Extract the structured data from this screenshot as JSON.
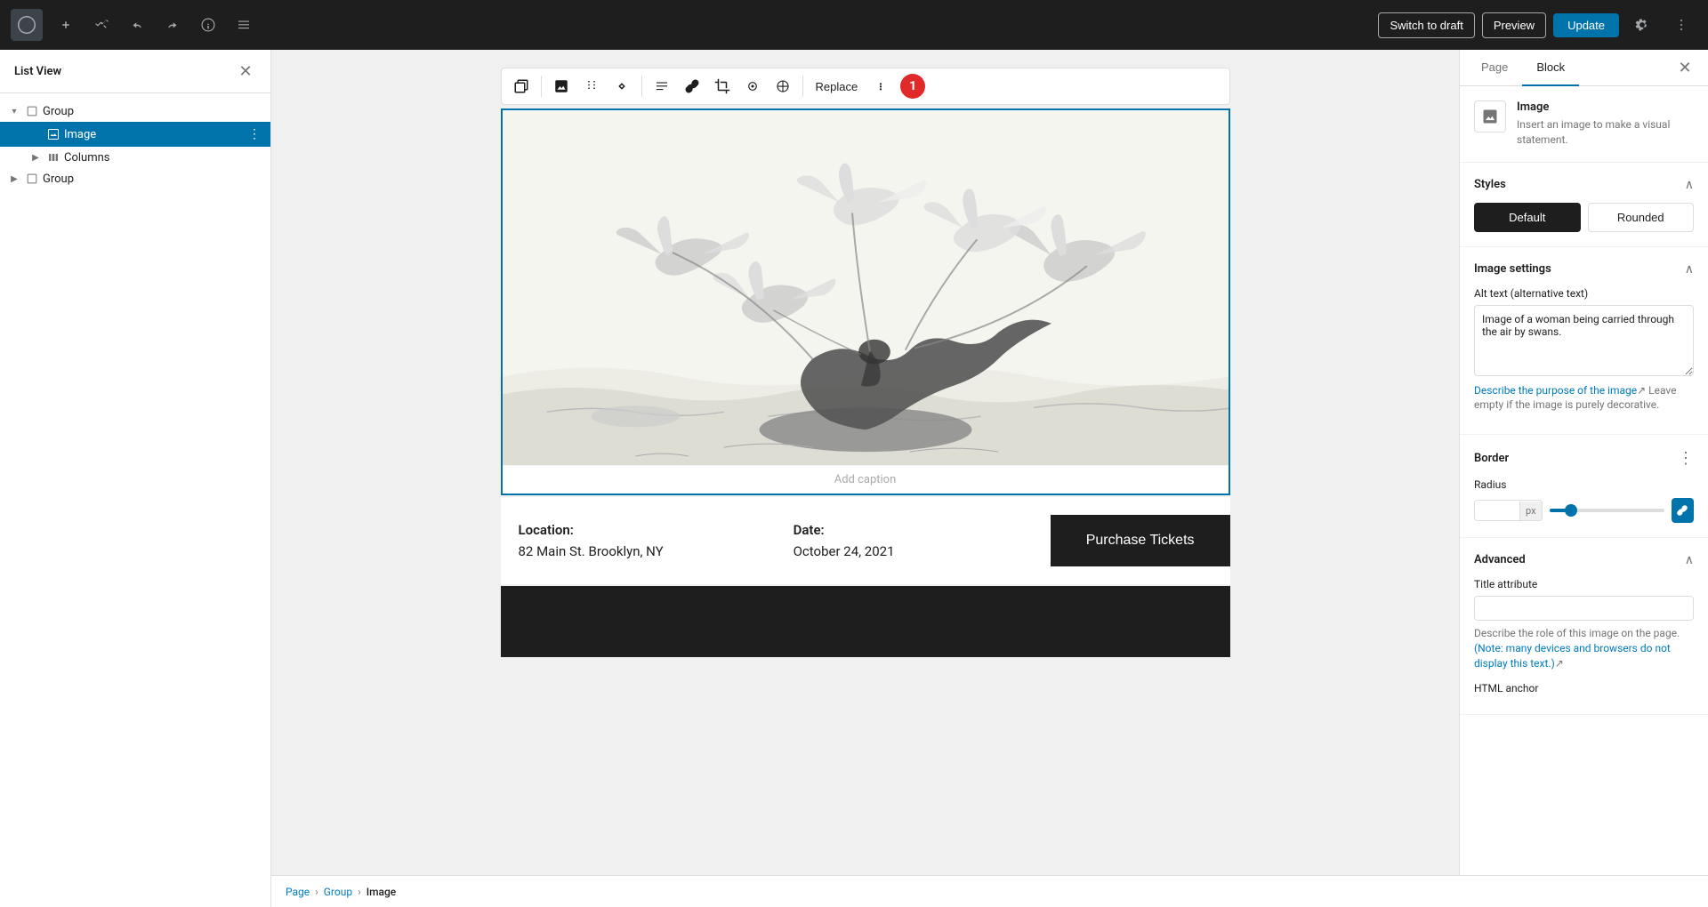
{
  "topbar": {
    "switch_draft_label": "Switch to draft",
    "preview_label": "Preview",
    "update_label": "Update"
  },
  "list_view": {
    "title": "List View",
    "items": [
      {
        "id": "group1",
        "label": "Group",
        "level": 0,
        "type": "group",
        "expanded": true
      },
      {
        "id": "image1",
        "label": "Image",
        "level": 1,
        "type": "image",
        "selected": true
      },
      {
        "id": "columns1",
        "label": "Columns",
        "level": 1,
        "type": "columns",
        "expanded": false
      },
      {
        "id": "group2",
        "label": "Group",
        "level": 0,
        "type": "group",
        "expanded": false
      }
    ]
  },
  "toolbar": {
    "replace_label": "Replace",
    "badge": "1"
  },
  "content": {
    "image_caption": "Add caption",
    "location_label": "Location:",
    "location_value": "82 Main St. Brooklyn, NY",
    "date_label": "Date:",
    "date_value": "October 24, 2021",
    "purchase_btn": "Purchase Tickets"
  },
  "breadcrumb": {
    "page": "Page",
    "group": "Group",
    "image": "Image"
  },
  "right_sidebar": {
    "tab_page": "Page",
    "tab_block": "Block",
    "block_name": "Image",
    "block_description": "Insert an image to make a visual statement.",
    "styles_section": "Styles",
    "style_default": "Default",
    "style_rounded": "Rounded",
    "image_settings_section": "Image settings",
    "alt_text_label": "Alt text (alternative text)",
    "alt_text_value": "Image of a woman being carried through the air by swans.",
    "alt_text_link": "Describe the purpose of the image",
    "alt_text_note": "Leave empty if the image is purely decorative.",
    "border_section": "Border",
    "radius_label": "Radius",
    "radius_value": "",
    "radius_unit": "px",
    "advanced_section": "Advanced",
    "title_attribute_label": "Title attribute",
    "title_attribute_value": "",
    "title_note": "Describe the role of this image on the page.",
    "title_note_link": "(Note: many devices and browsers do not display this text.)",
    "html_anchor_label": "HTML anchor"
  }
}
